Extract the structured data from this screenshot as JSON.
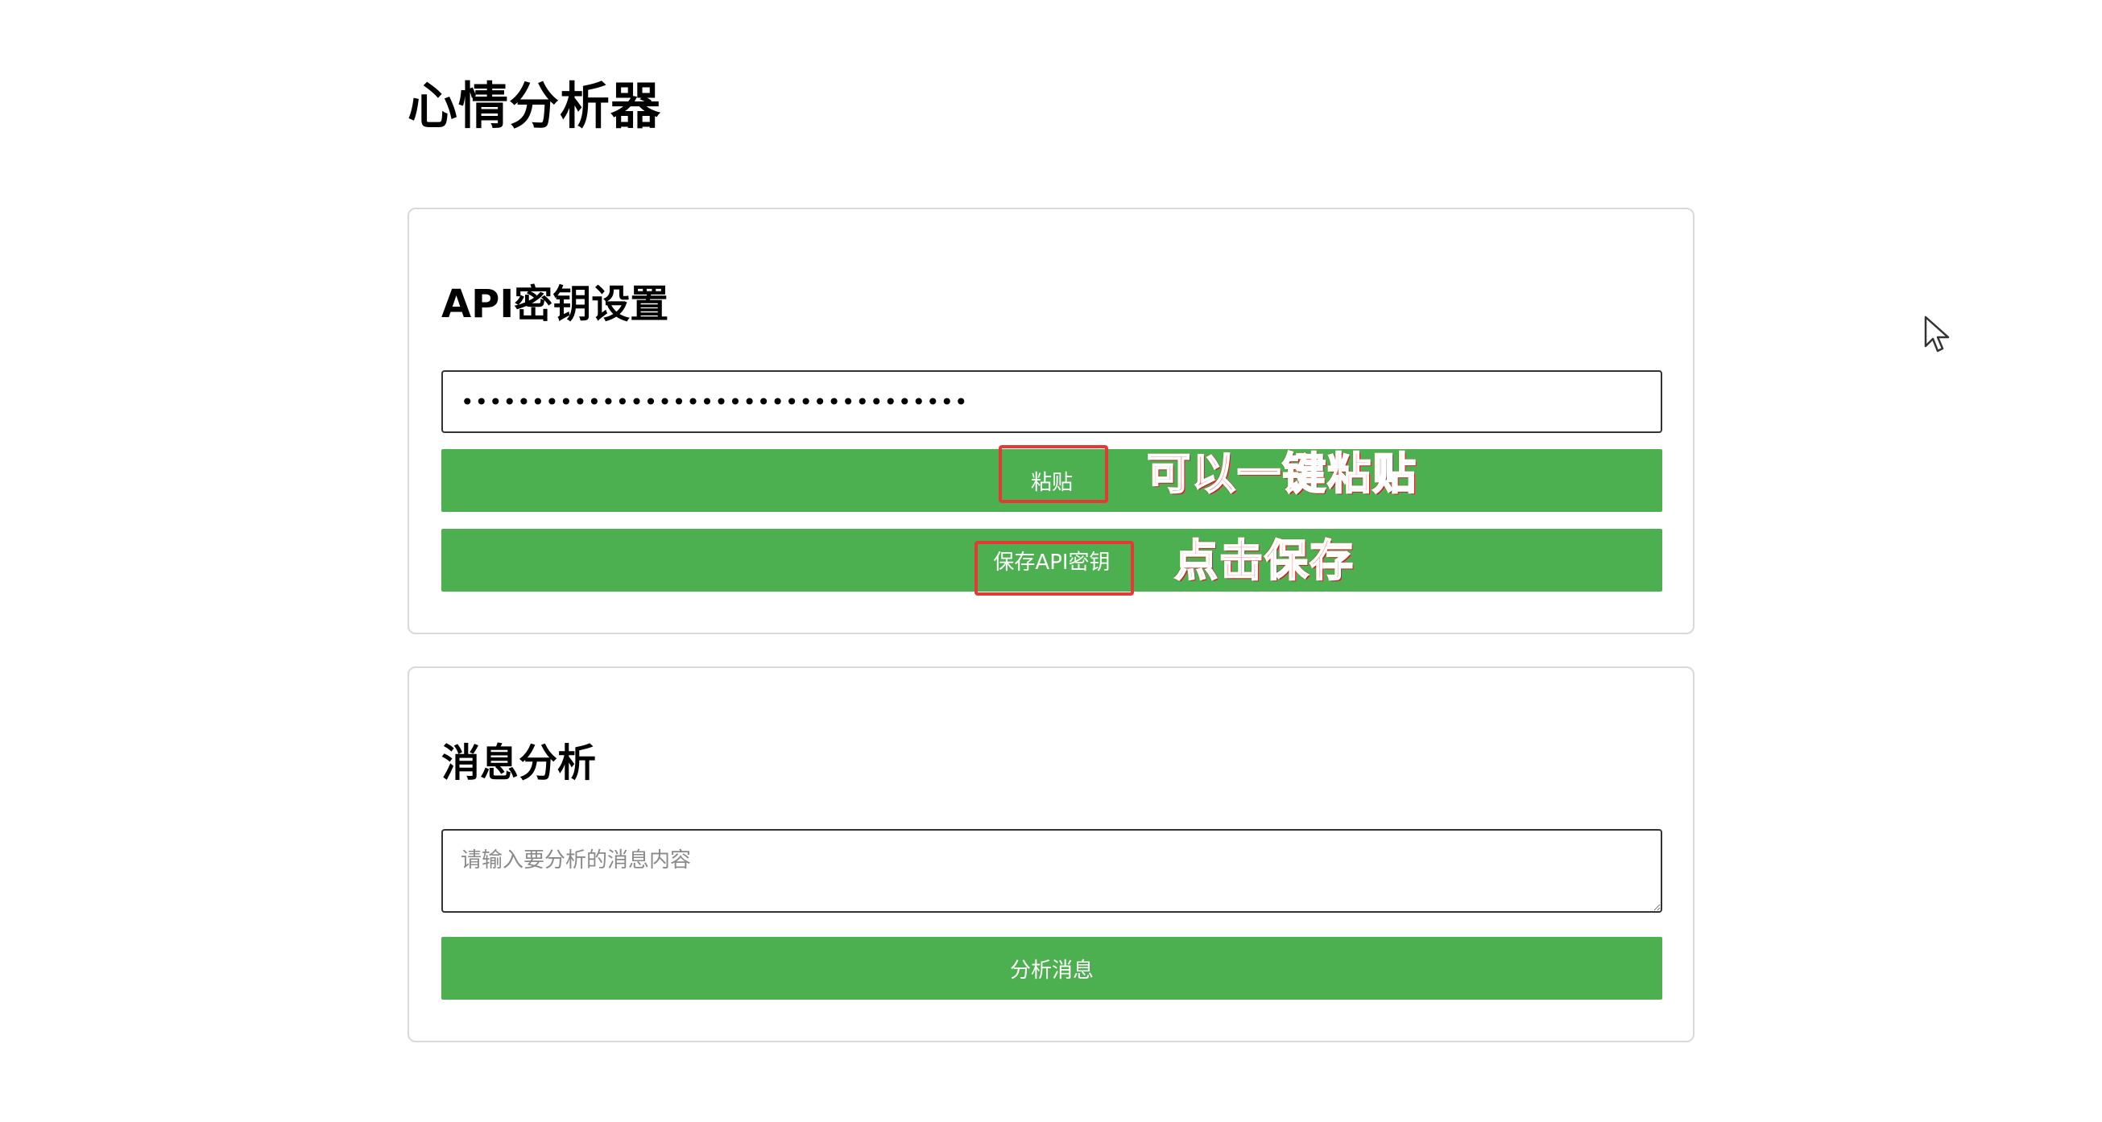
{
  "app": {
    "title": "心情分析器"
  },
  "api_section": {
    "title": "API密钥设置",
    "api_key_value": "••••••••••••••••••••••••••••••••••••",
    "paste_label": "粘贴",
    "save_label": "保存API密钥"
  },
  "message_section": {
    "title": "消息分析",
    "input_placeholder": "请输入要分析的消息内容",
    "analyze_label": "分析消息"
  },
  "annotations": {
    "paste_note": "可以一键粘贴",
    "save_note": "点击保存",
    "color": "#e53935"
  },
  "colors": {
    "button_green": "#4caf50",
    "border_gray": "#d9d9d9"
  }
}
